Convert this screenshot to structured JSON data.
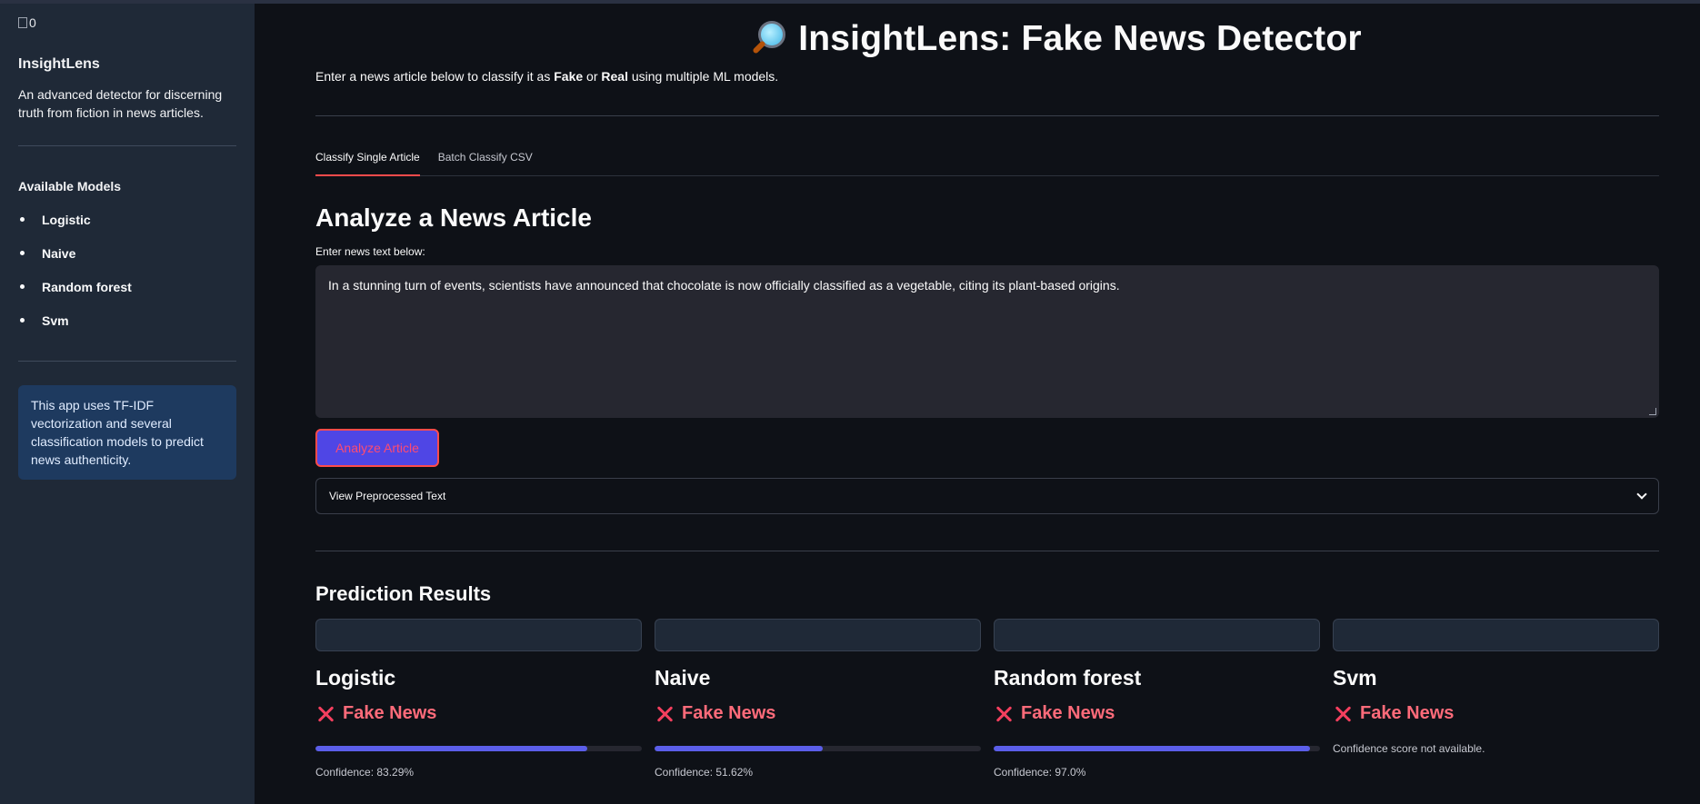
{
  "sidebar": {
    "logo_alt": "0",
    "title": "InsightLens",
    "description": "An advanced detector for discerning truth from fiction in news articles.",
    "models_title": "Available Models",
    "models": [
      "Logistic",
      "Naive",
      "Random forest",
      "Svm"
    ],
    "info": "This app uses TF-IDF vectorization and several classification models to predict news authenticity."
  },
  "header": {
    "icon": "magnifying-glass-icon",
    "title": "InsightLens: Fake News Detector",
    "intro_pre": "Enter a news article below to classify it as ",
    "intro_fake": "Fake",
    "intro_mid": " or ",
    "intro_real": "Real",
    "intro_post": " using multiple ML models."
  },
  "tabs": [
    {
      "label": "Classify Single Article",
      "active": true
    },
    {
      "label": "Batch Classify CSV",
      "active": false
    }
  ],
  "analyze": {
    "section_title": "Analyze a News Article",
    "field_label": "Enter news text below:",
    "text": "In a stunning turn of events, scientists have announced that chocolate is now officially classified as a vegetable, citing its plant-based origins.",
    "button_label": "Analyze Article",
    "expander_label": "View Preprocessed Text"
  },
  "results": {
    "title": "Prediction Results",
    "cards": [
      {
        "model": "Logistic",
        "verdict": "Fake News",
        "confidence": 83.29,
        "confidence_label": "Confidence: 83.29%"
      },
      {
        "model": "Naive",
        "verdict": "Fake News",
        "confidence": 51.62,
        "confidence_label": "Confidence: 51.62%"
      },
      {
        "model": "Random forest",
        "verdict": "Fake News",
        "confidence": 97.0,
        "confidence_label": "Confidence: 97.0%"
      },
      {
        "model": "Svm",
        "verdict": "Fake News",
        "confidence": null,
        "confidence_label": "Confidence score not available."
      }
    ]
  },
  "colors": {
    "accent": "#5b5ee9",
    "fake": "#ff6b7a",
    "sidebar_bg": "#1f2937",
    "main_bg": "#0e1117"
  }
}
